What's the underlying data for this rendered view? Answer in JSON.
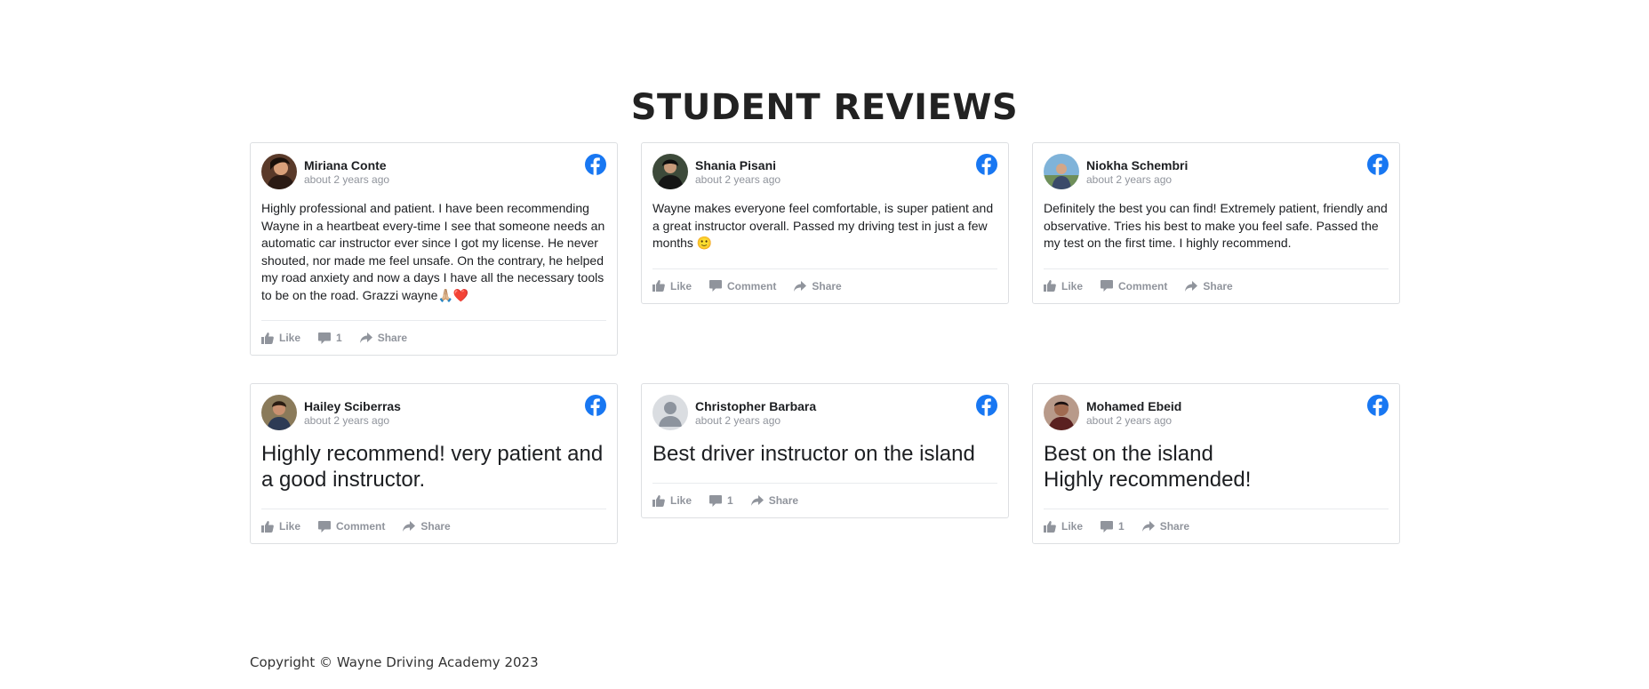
{
  "section_title": "STUDENT REVIEWS",
  "reviews": [
    {
      "author": "Miriana Conte",
      "time": "about 2 years ago",
      "text": "Highly professional and patient. I have been recommending Wayne in a heartbeat every-time I see that someone needs an automatic car instructor ever since I got my license. He never shouted, nor made me feel unsafe. On the contrary, he helped my road anxiety and now a days I have all the necessary tools to be on the road. Grazzi wayne🙏🏼❤️",
      "like_label": "Like",
      "comment_label": "1",
      "share_label": "Share",
      "avatar_icon": "user-photo-icon"
    },
    {
      "author": "Shania Pisani",
      "time": "about 2 years ago",
      "text": "Wayne makes everyone feel comfortable, is super patient and a great instructor overall. Passed my driving test in just a few months 🙂",
      "like_label": "Like",
      "comment_label": "Comment",
      "share_label": "Share",
      "avatar_icon": "user-photo-icon"
    },
    {
      "author": "Niokha Schembri",
      "time": "about 2 years ago",
      "text": "Definitely the best you can find! Extremely patient, friendly and observative. Tries his best to make you feel safe. Passed the my test on the first time. I highly recommend.",
      "like_label": "Like",
      "comment_label": "Comment",
      "share_label": "Share",
      "avatar_icon": "user-photo-icon"
    },
    {
      "author": "Hailey Sciberras",
      "time": "about 2 years ago",
      "text": "Highly recommend! very patient and a good instructor.",
      "like_label": "Like",
      "comment_label": "Comment",
      "share_label": "Share",
      "avatar_icon": "user-photo-icon"
    },
    {
      "author": "Christopher Barbara",
      "time": "about 2 years ago",
      "text": "Best driver instructor on the island",
      "like_label": "Like",
      "comment_label": "1",
      "share_label": "Share",
      "avatar_icon": "default-avatar-icon"
    },
    {
      "author": "Mohamed Ebeid",
      "time": "about 2 years ago",
      "text": "Best on the island\nHighly recommended!",
      "like_label": "Like",
      "comment_label": "1",
      "share_label": "Share",
      "avatar_icon": "user-photo-icon"
    }
  ],
  "footer": "Copyright © Wayne Driving Academy 2023",
  "colors": {
    "facebook_blue": "#1877f2",
    "action_gray": "#90949c",
    "border": "#dddfe2"
  }
}
